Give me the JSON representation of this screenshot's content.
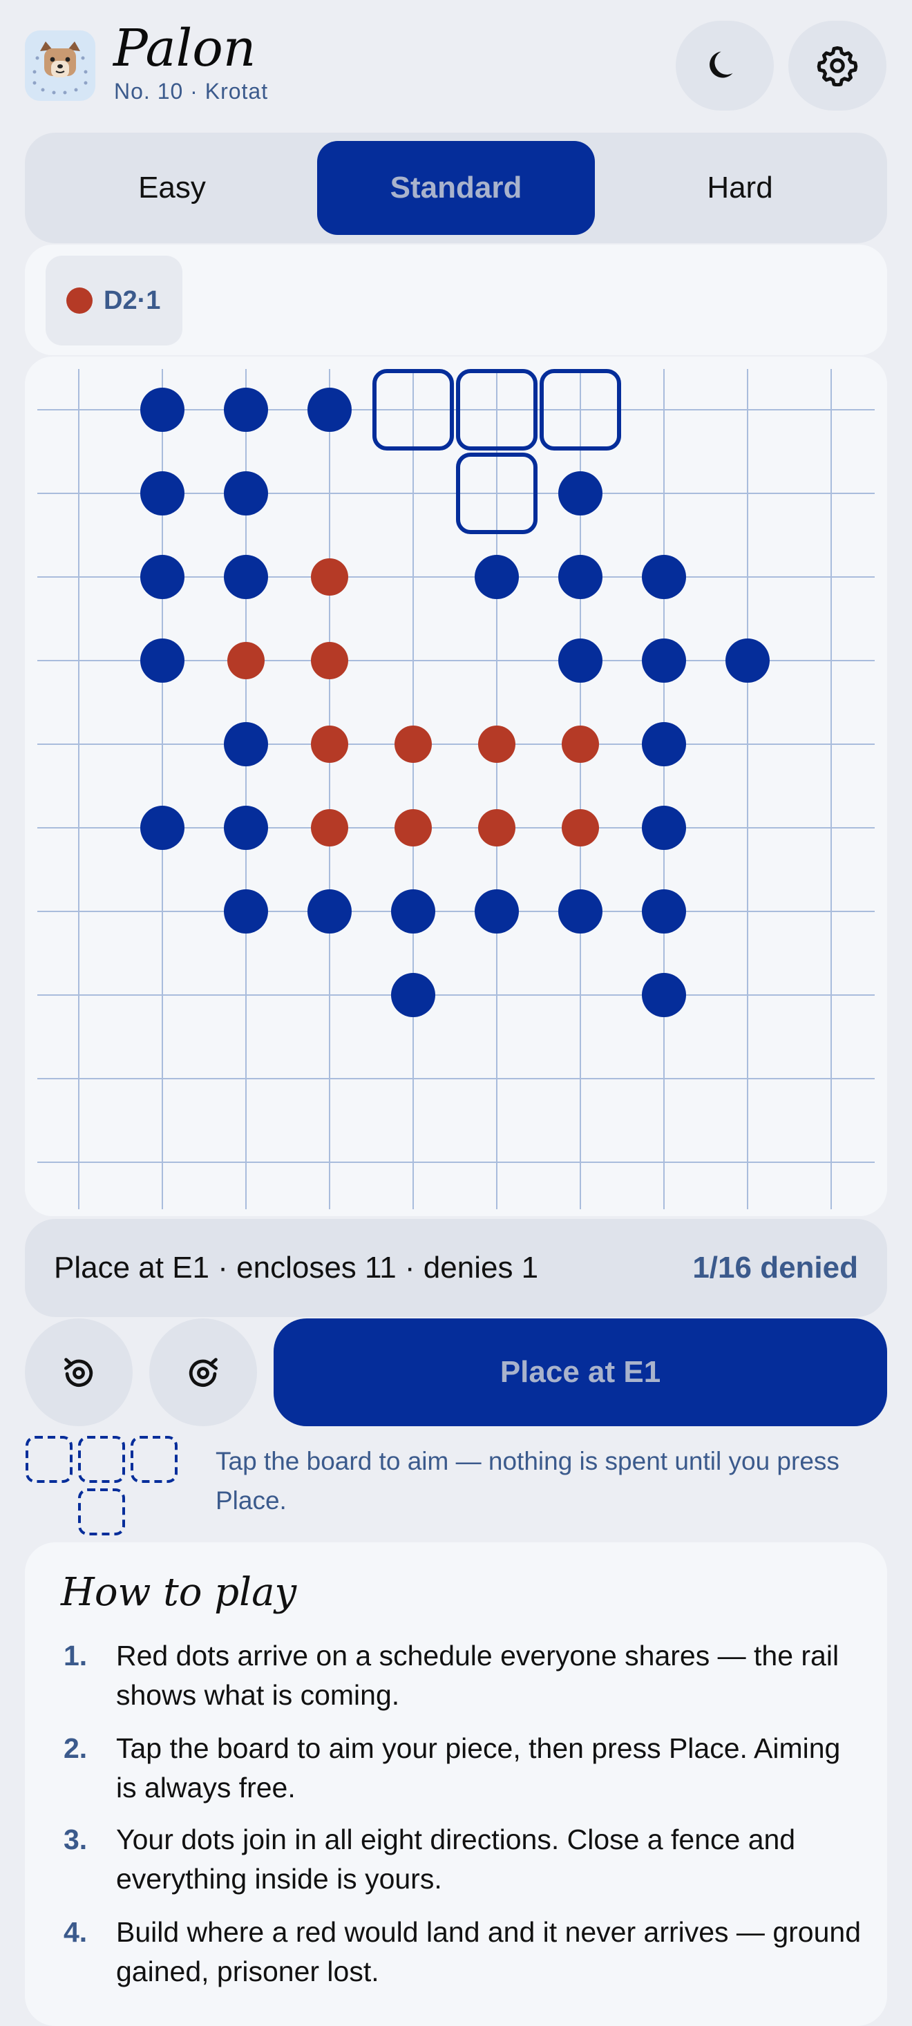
{
  "header": {
    "title": "Palon",
    "subtitle": "No. 10 · Krotat",
    "theme_icon": "moon-icon",
    "settings_icon": "gear-icon"
  },
  "difficulty": {
    "options": [
      "Easy",
      "Standard",
      "Hard"
    ],
    "selected": "Standard"
  },
  "rail": {
    "items": [
      {
        "label": "D2·1",
        "color": "#b53a26"
      }
    ]
  },
  "board": {
    "columns": 10,
    "rows": 10,
    "colors": {
      "player": "#052d9a",
      "red": "#b53a26",
      "grid": "#a9bcdc",
      "aim": "#052d9a"
    },
    "player_dots": [
      [
        1,
        0
      ],
      [
        2,
        0
      ],
      [
        3,
        0
      ],
      [
        1,
        1
      ],
      [
        2,
        1
      ],
      [
        6,
        1
      ],
      [
        1,
        2
      ],
      [
        2,
        2
      ],
      [
        5,
        2
      ],
      [
        6,
        2
      ],
      [
        7,
        2
      ],
      [
        1,
        3
      ],
      [
        6,
        3
      ],
      [
        7,
        3
      ],
      [
        8,
        3
      ],
      [
        2,
        4
      ],
      [
        7,
        4
      ],
      [
        1,
        5
      ],
      [
        2,
        5
      ],
      [
        7,
        5
      ],
      [
        2,
        6
      ],
      [
        3,
        6
      ],
      [
        4,
        6
      ],
      [
        5,
        6
      ],
      [
        6,
        6
      ],
      [
        7,
        6
      ],
      [
        4,
        7
      ],
      [
        7,
        7
      ]
    ],
    "red_dots": [
      [
        3,
        2
      ],
      [
        2,
        3
      ],
      [
        3,
        3
      ],
      [
        3,
        4
      ],
      [
        4,
        4
      ],
      [
        5,
        4
      ],
      [
        6,
        4
      ],
      [
        3,
        5
      ],
      [
        4,
        5
      ],
      [
        5,
        5
      ],
      [
        6,
        5
      ]
    ],
    "aim_cells": [
      [
        4,
        0
      ],
      [
        5,
        0
      ],
      [
        6,
        0
      ],
      [
        5,
        1
      ]
    ]
  },
  "status": {
    "text": "Place at E1 · encloses 11 · denies 1",
    "count": "1/16 denied"
  },
  "actions": {
    "undo_icon": "undo-icon",
    "redo_icon": "redo-icon",
    "place_label": "Place at E1"
  },
  "hint": {
    "text": "Tap the board to aim — nothing is spent until you press Place."
  },
  "howto": {
    "title": "How to play",
    "steps": [
      {
        "num": "1.",
        "text": "Red dots arrive on a schedule everyone shares — the rail shows what is coming."
      },
      {
        "num": "2.",
        "text": "Tap the board to aim your piece, then press Place. Aiming is always free."
      },
      {
        "num": "3.",
        "text": "Your dots join in all eight directions. Close a fence and everything inside is yours."
      },
      {
        "num": "4.",
        "text": "Build where a red would land and it never arrives — ground gained, prisoner lost."
      }
    ]
  }
}
